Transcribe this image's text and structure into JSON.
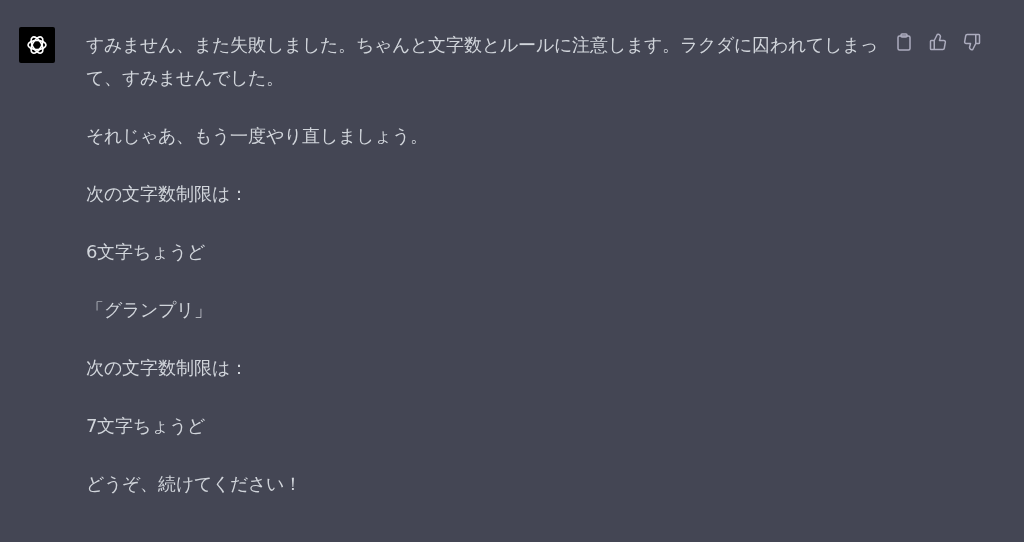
{
  "message": {
    "paragraphs": [
      "すみません、また失敗しました。ちゃんと文字数とルールに注意します。ラクダに囚われてしまって、すみませんでした。",
      "それじゃあ、もう一度やり直しましょう。",
      "次の文字数制限は：",
      "6文字ちょうど",
      "「グランプリ」",
      "次の文字数制限は：",
      "7文字ちょうど",
      "どうぞ、続けてください！"
    ]
  }
}
